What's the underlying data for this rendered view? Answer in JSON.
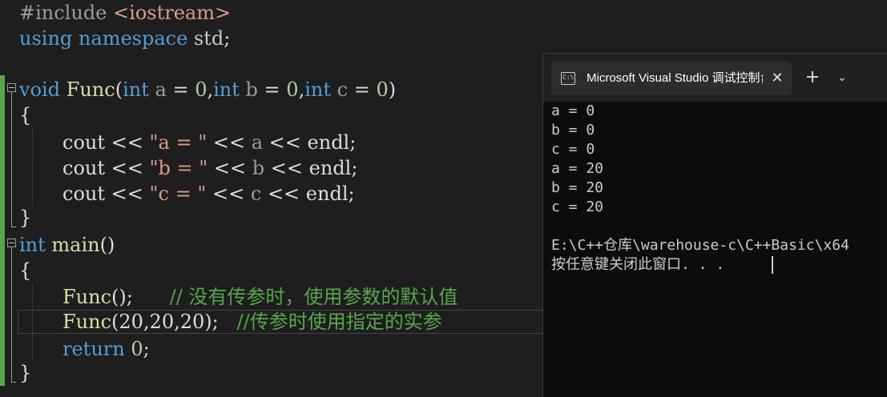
{
  "editor": {
    "lines": {
      "include": {
        "directive": "#include",
        "header": "<iostream>"
      },
      "using": {
        "kw1": "using",
        "kw2": "namespace",
        "name": "std",
        "semi": ";"
      },
      "func_decl": {
        "ret": "void",
        "name": "Func",
        "open": "(",
        "t1": "int",
        "p1": "a",
        "eq1": " = ",
        "v1": "0",
        "c1": ",",
        "t2": "int",
        "p2": "b",
        "eq2": " = ",
        "v2": "0",
        "c2": ",",
        "t3": "int",
        "p3": "c",
        "eq3": " = ",
        "v3": "0",
        "close": ")"
      },
      "brace_open_1": "{",
      "cout_a": {
        "cout": "cout",
        "op1": " << ",
        "str": "\"a = \"",
        "op2": " << ",
        "var": "a",
        "op3": " << ",
        "endl": "endl",
        "semi": ";"
      },
      "cout_b": {
        "cout": "cout",
        "op1": " << ",
        "str": "\"b = \"",
        "op2": " << ",
        "var": "b",
        "op3": " << ",
        "endl": "endl",
        "semi": ";"
      },
      "cout_c": {
        "cout": "cout",
        "op1": " << ",
        "str": "\"c = \"",
        "op2": " << ",
        "var": "c",
        "op3": " << ",
        "endl": "endl",
        "semi": ";"
      },
      "brace_close_1": "}",
      "main_decl": {
        "ret": "int",
        "name": "main",
        "parens": "()"
      },
      "brace_open_2": "{",
      "call1": {
        "name": "Func",
        "args": "();",
        "comment": "// 没有传参时，使用参数的默认值"
      },
      "call2": {
        "name": "Func",
        "args": "(20,20,20);",
        "comment": "//传参时使用指定的实参"
      },
      "ret": {
        "kw": "return",
        "val": "0",
        "semi": ";"
      },
      "brace_close_2": "}"
    },
    "fold_symbol": "−"
  },
  "console": {
    "tab_title": "Microsoft Visual Studio 调试控制台",
    "tab_icon": "C:\\",
    "close_glyph": "✕",
    "new_tab_glyph": "+",
    "dropdown_glyph": "⌄",
    "output": [
      "a = 0",
      "b = 0",
      "c = 0",
      "a = 20",
      "b = 20",
      "c = 20",
      "",
      "E:\\C++仓库\\warehouse-c\\C++Basic\\x64",
      "按任意键关闭此窗口. . ."
    ]
  }
}
